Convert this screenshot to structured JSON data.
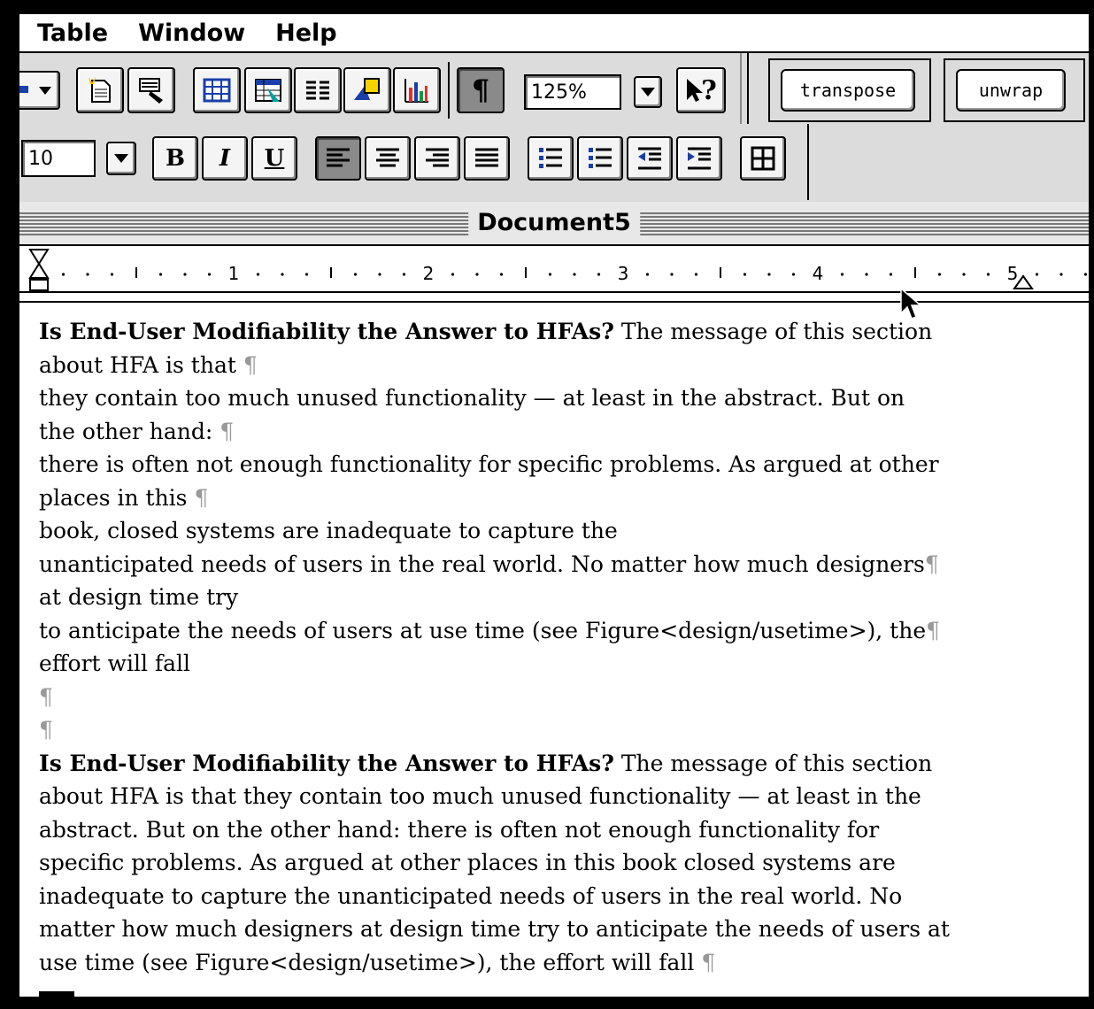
{
  "menubar": {
    "items": [
      "Table",
      "Window",
      "Help"
    ]
  },
  "toolbar": {
    "zoom_value": "125%",
    "font_size_value": "10",
    "transpose_label": "transpose",
    "unwrap_label": "unwrap",
    "bold_label": "B",
    "italic_label": "I",
    "underline_label": "U",
    "pilcrow_label": "¶",
    "help_label": "?"
  },
  "window": {
    "title": "Document5"
  },
  "ruler": {
    "numbers": [
      "1",
      "2",
      "3",
      "4",
      "5"
    ]
  },
  "document": {
    "pilcrow": "¶",
    "block1": [
      {
        "bold": "Is End-User Modifiability  the  Answer to HFAs?",
        "text": " The message of this section"
      },
      {
        "text": "about HFA is that "
      },
      {
        "text": " they contain too much unused functionality — at least  in the abstract.  But on"
      },
      {
        "text": "the other hand:  "
      },
      {
        "text": "there is often not enough functionality for specific  problems. As argued at other"
      },
      {
        "text": "places in this  "
      },
      {
        "text": "book, closed systems are inadequate  to capture the  "
      },
      {
        "text": "unanticipated  needs of users in the real  world. No matter how much designers"
      },
      {
        "text": "at design time try  "
      },
      {
        "text": "to anticipate  the  needs of users at  use time (see Figure<design/usetime>),  the"
      },
      {
        "text": "effort will  fall  "
      }
    ],
    "block2": [
      {
        "bold": "Is End-User Modifiability  the  Answer to HFAs?",
        "text": " The message of this section"
      },
      {
        "text": "about HFA is that   they  contain too much unused functionality — at least  in the"
      },
      {
        "text": "abstract.  But on the other hand:   there is often not enough functionality for"
      },
      {
        "text": "specific  problems. As argued at  other places  in this  book closed systems are"
      },
      {
        "text": "inadequate  to capture the   unanticipated  needs of users in the real  world. No"
      },
      {
        "text": "matter how much designers at design time try   to anticipate  the  needs of users at"
      },
      {
        "text": "use time (see Figure<design/usetime>),  the  effort  will  fall   "
      }
    ]
  }
}
